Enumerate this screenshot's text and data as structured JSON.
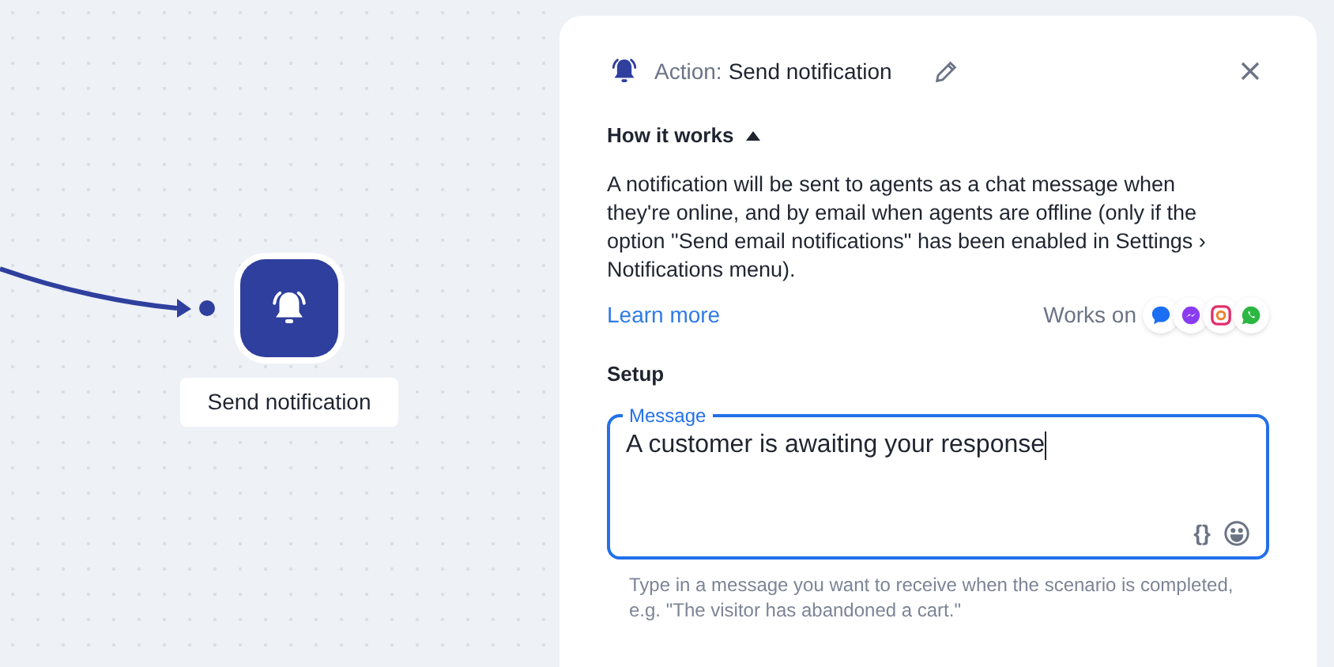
{
  "canvas": {
    "node": {
      "label": "Send notification"
    }
  },
  "panel": {
    "title_prefix": "Action:",
    "title": "Send notification",
    "how_it_works": {
      "label": "How it works",
      "expanded": true,
      "text": "A notification will be sent to agents as a chat message when they're online, and by email when agents are offline (only if the option \"Send email notifications\" has been enabled in Settings › Notifications menu).",
      "link": "Learn more",
      "works_on": "Works on"
    },
    "setup": {
      "heading": "Setup",
      "message": {
        "label": "Message",
        "value": "A customer is awaiting your response",
        "focused": true,
        "variables": "{}"
      },
      "hint": "Type in a message you want to receive when the scenario is completed, e.g. \"The visitor has abandoned a cart.\""
    }
  }
}
